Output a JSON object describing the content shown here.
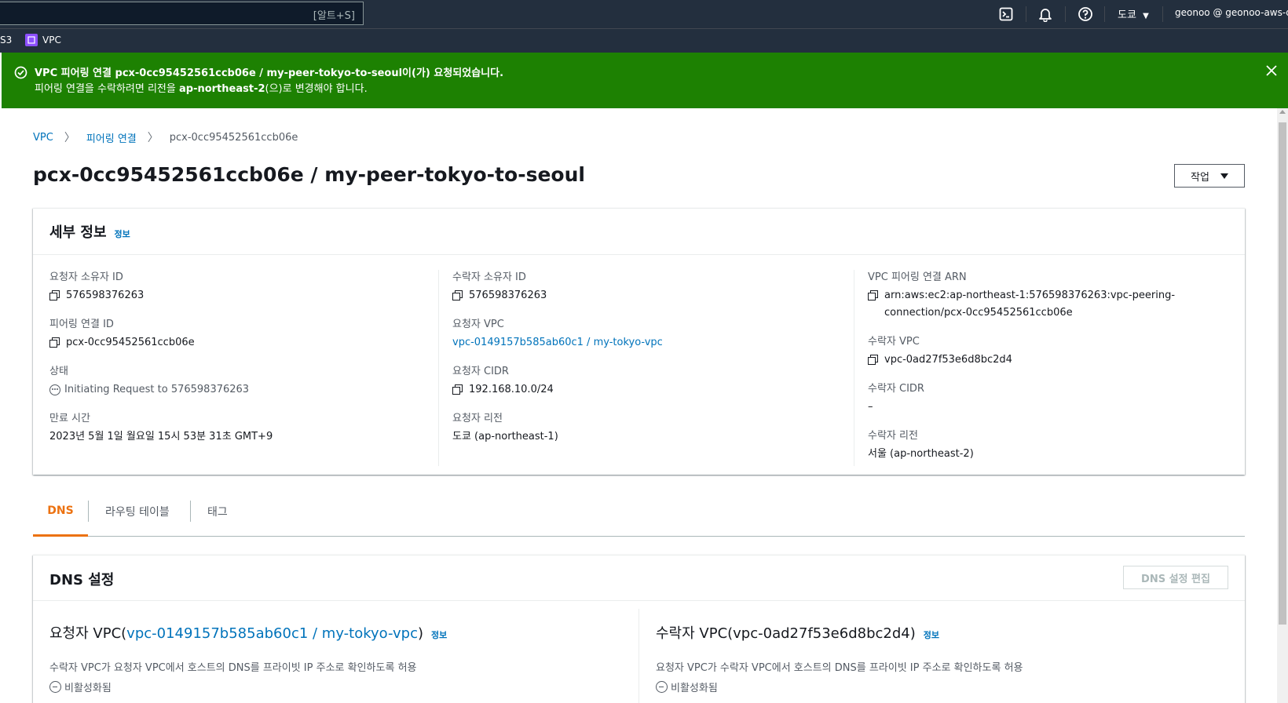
{
  "topnav": {
    "search_shortcut": "[알트+S]",
    "region": "도쿄",
    "account": "geonoo @ geonoo-aws-db"
  },
  "favorites": {
    "s3": "S3",
    "vpc": "VPC"
  },
  "flash": {
    "line1_prefix": "VPC 피어링 연결 ",
    "line1_id": "pcx-0cc95452561ccb06e / my-peer-tokyo-to-seoul",
    "line1_suffix": "이(가) 요청되었습니다.",
    "line2_prefix": "피어링 연결을 수락하려면 리전을 ",
    "line2_region": "ap-northeast-2",
    "line2_suffix": "(으)로 변경해야 합니다."
  },
  "breadcrumb": {
    "root": "VPC",
    "section": "피어링 연결",
    "current": "pcx-0cc95452561ccb06e"
  },
  "page": {
    "title": "pcx-0cc95452561ccb06e / my-peer-tokyo-to-seoul",
    "action_label": "작업"
  },
  "details": {
    "title": "세부 정보",
    "info": "정보",
    "requester_owner_label": "요청자 소유자 ID",
    "requester_owner_value": "576598376263",
    "peering_id_label": "피어링 연결 ID",
    "peering_id_value": "pcx-0cc95452561ccb06e",
    "status_label": "상태",
    "status_value": "Initiating Request to 576598376263",
    "expiration_label": "만료 시간",
    "expiration_value": "2023년 5월 1일 월요일 15시 53분 31초 GMT+9",
    "accepter_owner_label": "수락자 소유자 ID",
    "accepter_owner_value": "576598376263",
    "requester_vpc_label": "요청자 VPC",
    "requester_vpc_value": "vpc-0149157b585ab60c1 / my-tokyo-vpc",
    "requester_cidr_label": "요청자 CIDR",
    "requester_cidr_value": "192.168.10.0/24",
    "requester_region_label": "요청자 리전",
    "requester_region_value": "도쿄 (ap-northeast-1)",
    "arn_label": "VPC 피어링 연결 ARN",
    "arn_line1": "arn:aws:ec2:ap-northeast-1:576598376263:vpc-peering-",
    "arn_line2": "connection/pcx-0cc95452561ccb06e",
    "accepter_vpc_label": "수락자 VPC",
    "accepter_vpc_value": "vpc-0ad27f53e6d8bc2d4",
    "accepter_cidr_label": "수락자 CIDR",
    "accepter_cidr_value": "–",
    "accepter_region_label": "수락자 리전",
    "accepter_region_value": "서울 (ap-northeast-2)"
  },
  "tabs": [
    "DNS",
    "라우팅 테이블",
    "태그"
  ],
  "dns": {
    "title": "DNS 설정",
    "edit_label": "DNS 설정 편집",
    "requester_title_prefix": "요청자 VPC(",
    "requester_title_link": "vpc-0149157b585ab60c1 / my-tokyo-vpc",
    "requester_title_suffix": ")",
    "accepter_title": "수락자 VPC(vpc-0ad27f53e6d8bc2d4)",
    "info": "정보",
    "requester_desc": "수락자 VPC가 요청자 VPC에서 호스트의 DNS를 프라이빗 IP 주소로 확인하도록 허용",
    "accepter_desc": "요청자 VPC가 수락자 VPC에서 호스트의 DNS를 프라이빗 IP 주소로 확인하도록 허용",
    "requester_status": "비활성화됨",
    "accepter_status": "비활성화됨"
  }
}
